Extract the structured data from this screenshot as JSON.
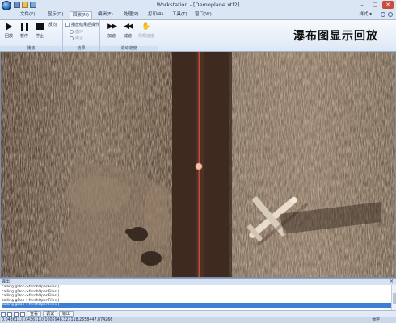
{
  "window": {
    "title": "Workstation - [Demoplane.xtf2]",
    "controls": [
      "–",
      "□",
      "✕"
    ]
  },
  "menu": {
    "tabs": [
      "文件(F)",
      "显示(D)",
      "回放(M)",
      "编辑(E)",
      "处理(P)",
      "打印(R)",
      "工具(T)",
      "窗口(W)"
    ],
    "active_tab": "回放(M)",
    "style_label": "样式 ▾"
  },
  "ribbon": {
    "playback": {
      "play": "回放",
      "pause": "暂停",
      "stop": "停止",
      "reverse": "反向",
      "group_label": "播放"
    },
    "result": {
      "option": "播放结果后操作",
      "radio_loop": "循环",
      "radio_stop": "停止",
      "group_label": "结果"
    },
    "speed": {
      "accelerate": "加速",
      "decelerate": "减速",
      "normal": "常规速度",
      "group_label": "滚动速度"
    },
    "heading": "瀑布图显示回放"
  },
  "output": {
    "title": "输出",
    "lines": [
      "calling gDoc->fnrchOpenFiles()",
      "calling gDoc->fnrchOpenFiles()",
      "calling gDoc->fnrchOpenFiles()",
      "calling gDoc->fnrchOpenFiles()",
      "calling gDoc->fnrchOpenFiles()"
    ],
    "selected_index": 4,
    "tabs": [
      "查看",
      "调试",
      "输出"
    ]
  },
  "status": {
    "coords": "0.043611,0.043611,0.1005948,327118,2658447.874266",
    "right": "数字"
  }
}
